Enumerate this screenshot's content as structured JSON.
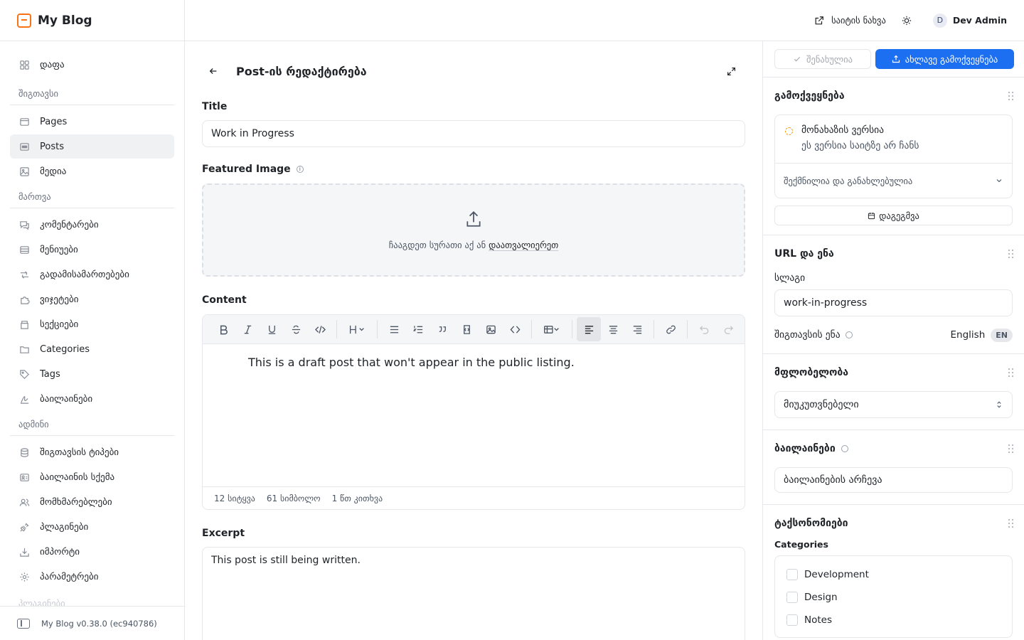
{
  "brand": {
    "name": "My Blog"
  },
  "sidebar": {
    "top_items": [
      {
        "label": "დაფა",
        "icon": "dashboard-icon"
      }
    ],
    "sections": [
      {
        "label": "შიგთავსი",
        "items": [
          {
            "label": "Pages",
            "icon": "pages-icon"
          },
          {
            "label": "Posts",
            "icon": "posts-icon",
            "active": true
          },
          {
            "label": "მედია",
            "icon": "media-icon"
          }
        ]
      },
      {
        "label": "მართვა",
        "items": [
          {
            "label": "კომენტარები",
            "icon": "comments-icon"
          },
          {
            "label": "მენიუები",
            "icon": "menus-icon"
          },
          {
            "label": "გადამისამართებები",
            "icon": "redirects-icon"
          },
          {
            "label": "ვიჯეტები",
            "icon": "widgets-icon"
          },
          {
            "label": "სექციები",
            "icon": "sections-icon"
          },
          {
            "label": "Categories",
            "icon": "folder-icon"
          },
          {
            "label": "Tags",
            "icon": "tag-icon"
          },
          {
            "label": "ბაილაინები",
            "icon": "bylines-icon"
          }
        ]
      },
      {
        "label": "ადმინი",
        "items": [
          {
            "label": "შიგთავსის ტიპები",
            "icon": "database-icon"
          },
          {
            "label": "ბაილაინის სქემა",
            "icon": "schema-icon"
          },
          {
            "label": "მომხმარებლები",
            "icon": "users-icon"
          },
          {
            "label": "პლაგინები",
            "icon": "plugin-icon"
          },
          {
            "label": "იმპორტი",
            "icon": "import-icon"
          },
          {
            "label": "პარამეტრები",
            "icon": "gear-icon"
          }
        ]
      }
    ],
    "faded_label": "პლაგინები",
    "footer_version": "My Blog v0.38.0 (ec940786)"
  },
  "topbar": {
    "view_site": "საიტის ნახვა",
    "user_initial": "D",
    "user_name": "Dev Admin"
  },
  "editor": {
    "title": "Post-ის რედაქტირება",
    "title_label": "Title",
    "title_value": "Work in Progress",
    "featured_label": "Featured Image",
    "dropzone_text": "ჩააგდეთ სურათი აქ ან",
    "dropzone_link": "დაათვალიერეთ",
    "content_label": "Content",
    "content_text": "This is a draft post that won't appear in the public listing.",
    "stats": {
      "words": "12 სიტყვა",
      "chars": "61 სიმბოლო",
      "read": "1 წთ კითხვა"
    },
    "excerpt_label": "Excerpt",
    "excerpt_value": "This post is still being written."
  },
  "right": {
    "saved_label": "შენახულია",
    "publish_label": "ახლავე გამოქვეყნება",
    "publish_title": "გამოქვეყნება",
    "status_title": "მონახაზის ვერსია",
    "status_desc": "ეს ვერსია საიტზე არ ჩანს",
    "status_row": "შექმნილია და განახლებულია",
    "schedule_label": "დაგეგმვა",
    "url_title": "URL და ენა",
    "slug_label": "სლაგი",
    "slug_value": "work-in-progress",
    "lang_label": "შიგთავსის ენა",
    "lang_value": "English",
    "lang_code": "EN",
    "ownership_title": "მფლობელობა",
    "ownership_value": "მიუკუთვნებელი",
    "bylines_title": "ბაილაინები",
    "bylines_placeholder": "ბაილაინების არჩევა",
    "taxonomies_title": "ტაქსონომიები",
    "categories_label": "Categories",
    "categories": [
      "Development",
      "Design",
      "Notes"
    ]
  },
  "colors": {
    "accent": "#1d6ff2",
    "brand": "#f97316",
    "draft": "#f59e0b"
  }
}
